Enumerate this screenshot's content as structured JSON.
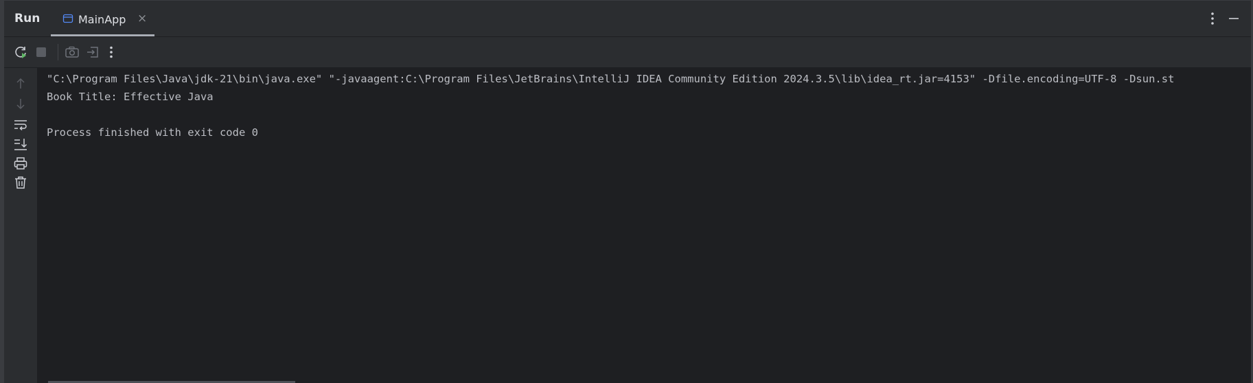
{
  "header": {
    "run_label": "Run",
    "tab_label": "MainApp",
    "tab_close": "×"
  },
  "console": {
    "lines": [
      "\"C:\\Program Files\\Java\\jdk-21\\bin\\java.exe\" \"-javaagent:C:\\Program Files\\JetBrains\\IntelliJ IDEA Community Edition 2024.3.5\\lib\\idea_rt.jar=4153\" -Dfile.encoding=UTF-8 -Dsun.st",
      "Book Title: Effective Java",
      "",
      "Process finished with exit code 0"
    ]
  },
  "colors": {
    "background": "#1e1f22",
    "panel": "#2b2d30",
    "text": "#bcbec4",
    "rerun_green": "#5fb865",
    "tab_icon_blue": "#548af7"
  },
  "icons": {
    "toolbar": [
      "rerun-icon",
      "stop-icon",
      "camera-icon",
      "exit-icon",
      "more-vertical-icon"
    ],
    "gutter": [
      "arrow-up-icon",
      "arrow-down-icon",
      "soft-wrap-icon",
      "scroll-to-end-icon",
      "print-icon",
      "trash-icon"
    ],
    "header": [
      "application-icon",
      "close-icon",
      "more-vertical-icon",
      "minimize-icon"
    ]
  }
}
